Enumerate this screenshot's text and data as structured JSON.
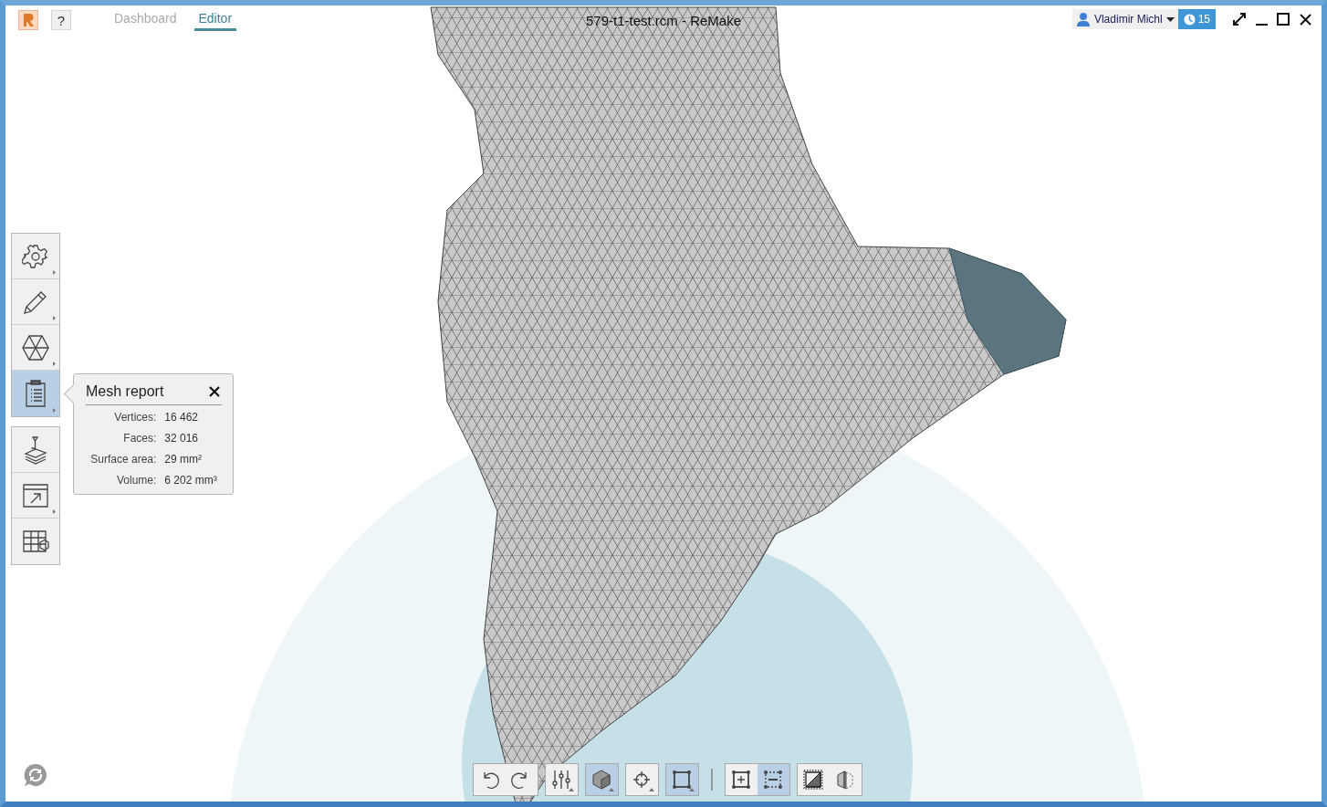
{
  "window": {
    "title": "579-t1-test.rcm - ReMake"
  },
  "tabs": [
    {
      "label": "Dashboard",
      "selected": false
    },
    {
      "label": "Editor",
      "selected": true
    }
  ],
  "help_button": "?",
  "user": {
    "name": "Vladimir Michl",
    "badge": "15"
  },
  "sidebar": {
    "groups": [
      [
        {
          "kind": "gear",
          "selected": false,
          "submenu": true
        },
        {
          "kind": "pencil",
          "selected": false,
          "submenu": true
        },
        {
          "kind": "hexagon",
          "selected": false,
          "submenu": true
        },
        {
          "kind": "clipboard",
          "selected": true,
          "submenu": true
        }
      ],
      [
        {
          "kind": "print",
          "selected": false,
          "submenu": false
        },
        {
          "kind": "export",
          "selected": false,
          "submenu": true
        },
        {
          "kind": "grid",
          "selected": false,
          "submenu": false
        }
      ]
    ]
  },
  "mesh_report": {
    "title": "Mesh report",
    "rows": [
      {
        "label": "Vertices:",
        "value": "16 462"
      },
      {
        "label": "Faces:",
        "value": "32 016"
      },
      {
        "label": "Surface area:",
        "value": "29 mm²"
      },
      {
        "label": "Volume:",
        "value": "6 202 mm³"
      }
    ]
  },
  "toolbar": {
    "groups": [
      [
        {
          "kind": "undo",
          "selected": false,
          "submenu": false
        },
        {
          "kind": "redo",
          "selected": false,
          "submenu": false
        }
      ],
      [
        {
          "kind": "sliders",
          "selected": false,
          "submenu": true
        }
      ],
      [
        {
          "kind": "cube",
          "selected": true,
          "submenu": true
        }
      ],
      [
        {
          "kind": "crosshair",
          "selected": false,
          "submenu": true
        }
      ],
      [
        {
          "kind": "square",
          "selected": true,
          "submenu": true
        }
      ],
      [
        {
          "kind": "select-add",
          "selected": false,
          "submenu": false
        },
        {
          "kind": "select-remove",
          "selected": true,
          "submenu": false
        }
      ],
      [
        {
          "kind": "half-square",
          "selected": false,
          "submenu": false
        },
        {
          "kind": "half-cube",
          "selected": false,
          "submenu": false
        }
      ]
    ]
  }
}
